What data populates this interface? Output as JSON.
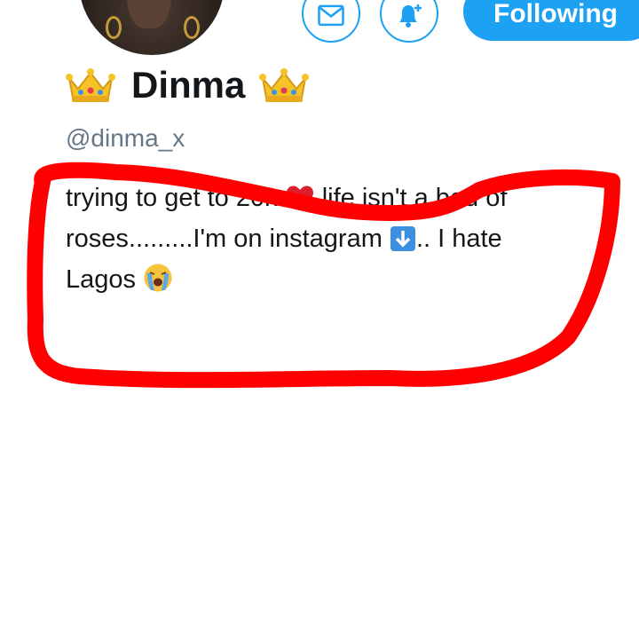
{
  "header": {
    "follow_label": "Following",
    "message_icon": "envelope-icon",
    "notify_icon": "bell-plus-icon"
  },
  "profile": {
    "left_emoji": "crown-emoji",
    "name": "Dinma",
    "right_emoji": "crown-emoji",
    "handle": "@dinma_x"
  },
  "bio": {
    "line1_a": "trying to get to 20k",
    "line1_emoji": "red-heart-emoji",
    "line1_b": "life isn't a bed of",
    "line2_a": "roses.........I'm on instagram",
    "line2_emoji": "down-arrow-emoji",
    "line2_b": ".. I hate",
    "line3_a": "Lagos",
    "line3_emoji": "crying-face-emoji"
  },
  "colors": {
    "accent": "#1da1f2",
    "name_text": "#14171a",
    "handle_text": "#657786",
    "annotation": "#ff0000"
  }
}
